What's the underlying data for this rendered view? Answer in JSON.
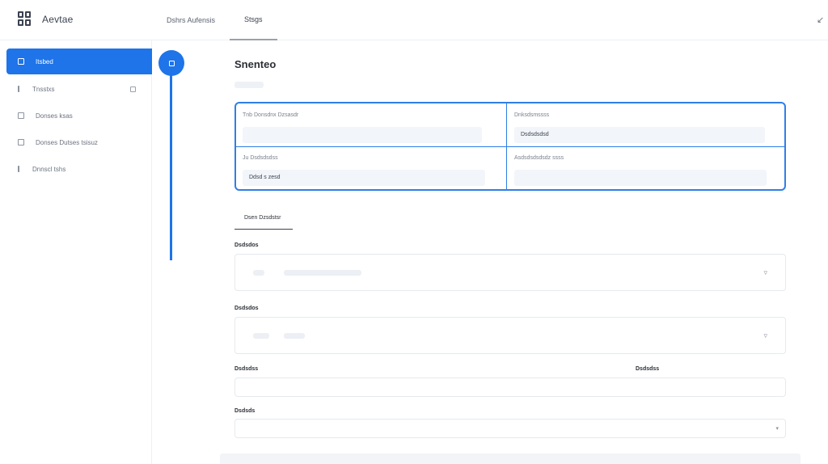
{
  "app": {
    "brand_name": "Aevtae"
  },
  "header": {
    "tabs": [
      {
        "label": "Dshrs Aufensis"
      },
      {
        "label": "Stsgs"
      }
    ],
    "right_icon": "collapse-icon"
  },
  "sidebar": {
    "items": [
      {
        "label": "Itsbed",
        "icon": "square-icon"
      },
      {
        "label": "Tnsstxs",
        "icon": "list-icon"
      },
      {
        "label": "Donses ksas",
        "icon": "square-icon"
      },
      {
        "label": "Donses Dutses tsisuz",
        "icon": "square-icon"
      },
      {
        "label": "Dnnscl tshs",
        "icon": "list-icon"
      }
    ]
  },
  "main": {
    "title": "Snenteo",
    "info": {
      "c1_label": "Tnb Donsdnx Dzsasdr",
      "c2_label": "Dnksdsmssss",
      "c2_value": "Dsdsdsdsd",
      "c3_label": "Ju Dsdsdsdss",
      "c3_value": "Ddsd s zesd",
      "c4_label": "Asdsdsdsdsdz ssss"
    },
    "section_tab": "Dsen Dzsdstsr",
    "fields": {
      "f1_label": "Dsdsdos",
      "f2_label": "Dsdsdos",
      "f3_label": "Dsdsdss",
      "f3b_label": "Dsdsdss",
      "f4_label": "Dsdsds"
    }
  },
  "colors": {
    "accent": "#1e74e8",
    "border_accent": "#2f7fe6"
  }
}
